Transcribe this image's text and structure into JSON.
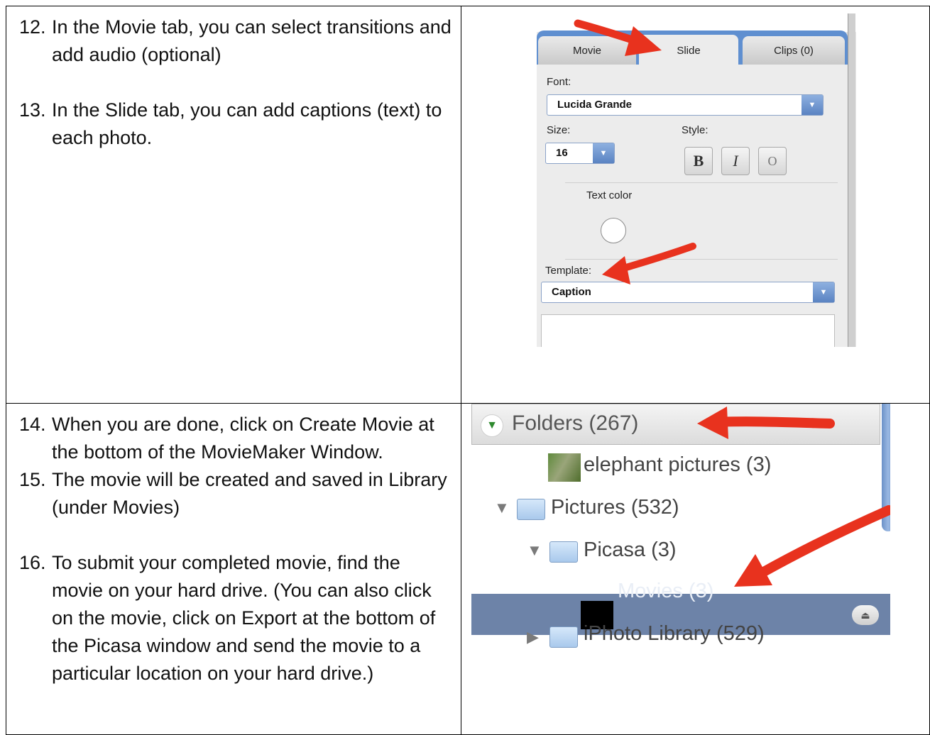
{
  "steps": [
    {
      "num": "12.",
      "text": "In the Movie tab, you can select transitions and add audio (optional)"
    },
    {
      "num": "13.",
      "text": "In the Slide tab, you can add captions (text) to each photo."
    },
    {
      "num": "14.",
      "text": "When you are done, click on Create Movie at the bottom of the MovieMaker Window."
    },
    {
      "num": "15.",
      "text": "The movie will be created and saved in Library (under Movies)"
    },
    {
      "num": "16.",
      "text": "To submit your completed movie, find the movie on your hard drive. (You can also click on the movie, click on Export at the bottom of the Picasa window and send the movie to a particular location on your hard drive.)"
    }
  ],
  "slide_panel": {
    "tabs": {
      "movie": "Movie",
      "slide": "Slide",
      "clips": "Clips (0)"
    },
    "font_label": "Font:",
    "font_value": "Lucida Grande",
    "size_label": "Size:",
    "size_value": "16",
    "style_label": "Style:",
    "style_buttons": {
      "bold": "B",
      "italic": "I",
      "outline": "O"
    },
    "text_color_label": "Text color",
    "template_label": "Template:",
    "template_value": "Caption",
    "arrow_color": "#e8321e"
  },
  "folder_list": {
    "header": "Folders (267)",
    "items": [
      {
        "label": "elephant pictures (3)"
      },
      {
        "label": "Pictures (532)"
      },
      {
        "label": "Picasa (3)"
      },
      {
        "label": "Movies (3)"
      },
      {
        "label": "iPhoto Library (529)"
      }
    ],
    "selection_color": "#6d83a8"
  }
}
